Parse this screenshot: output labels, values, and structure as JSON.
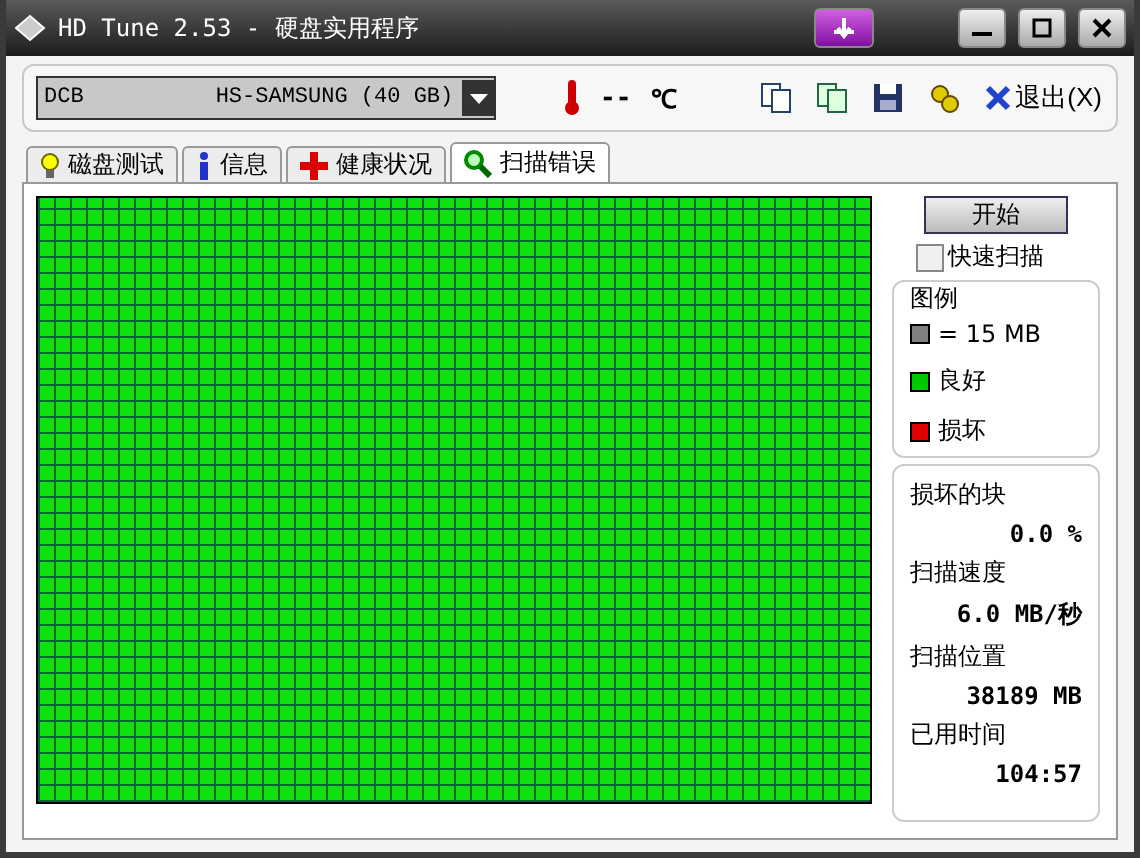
{
  "window": {
    "title": "HD Tune 2.53 - 硬盘实用程序"
  },
  "toolbar": {
    "drive": "DCB          HS-SAMSUNG (40 GB)",
    "temperature": "--",
    "temperature_unit": "℃",
    "exit_label": "退出(X)"
  },
  "tabs": [
    {
      "label": "磁盘测试",
      "selected": false
    },
    {
      "label": "信息",
      "selected": false
    },
    {
      "label": "健康状况",
      "selected": false
    },
    {
      "label": "扫描错误",
      "selected": true
    }
  ],
  "scan": {
    "start_button": "开始",
    "quick_scan": {
      "label": "快速扫描",
      "checked": false
    }
  },
  "legend": {
    "title": "图例",
    "items": [
      {
        "label": "= 15 MB",
        "color": "#808080"
      },
      {
        "label": "良好",
        "color": "#00c800"
      },
      {
        "label": "损坏",
        "color": "#e00000"
      }
    ]
  },
  "stats": [
    {
      "label": "损坏的块",
      "value": "0.0 %"
    },
    {
      "label": "扫描速度",
      "value": "6.0 MB/秒"
    },
    {
      "label": "扫描位置",
      "value": "38189 MB"
    },
    {
      "label": "已用时间",
      "value": "104:57"
    }
  ]
}
